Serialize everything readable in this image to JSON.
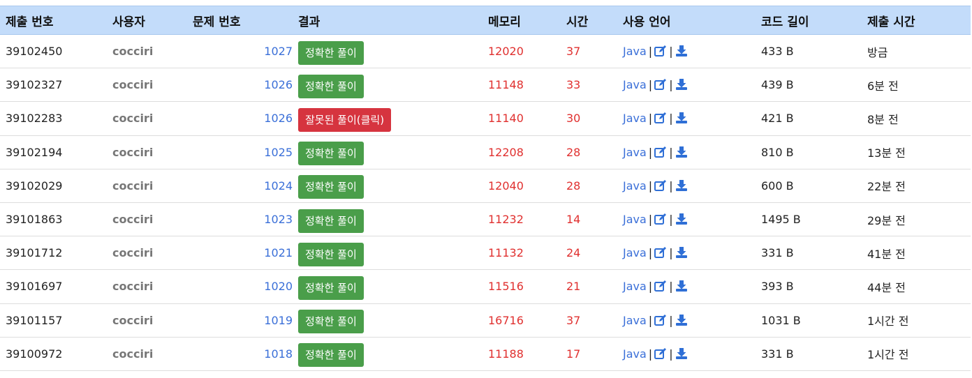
{
  "table": {
    "headers": [
      "제출 번호",
      "사용자",
      "문제 번호",
      "결과",
      "메모리",
      "시간",
      "사용 언어",
      "코드 길이",
      "제출 시간"
    ],
    "rows": [
      {
        "submission_id": "39102450",
        "user": "cocciri",
        "problem": "1027",
        "result": "정확한 풀이",
        "result_type": "ac",
        "memory": "12020",
        "time": "37",
        "language": "Java",
        "code_length": "433 B",
        "submitted": "방금"
      },
      {
        "submission_id": "39102327",
        "user": "cocciri",
        "problem": "1026",
        "result": "정확한 풀이",
        "result_type": "ac",
        "memory": "11148",
        "time": "33",
        "language": "Java",
        "code_length": "439 B",
        "submitted": "6분 전"
      },
      {
        "submission_id": "39102283",
        "user": "cocciri",
        "problem": "1026",
        "result": "잘못된 풀이(클릭)",
        "result_type": "wa",
        "memory": "11140",
        "time": "30",
        "language": "Java",
        "code_length": "421 B",
        "submitted": "8분 전"
      },
      {
        "submission_id": "39102194",
        "user": "cocciri",
        "problem": "1025",
        "result": "정확한 풀이",
        "result_type": "ac",
        "memory": "12208",
        "time": "28",
        "language": "Java",
        "code_length": "810 B",
        "submitted": "13분 전"
      },
      {
        "submission_id": "39102029",
        "user": "cocciri",
        "problem": "1024",
        "result": "정확한 풀이",
        "result_type": "ac",
        "memory": "12040",
        "time": "28",
        "language": "Java",
        "code_length": "600 B",
        "submitted": "22분 전"
      },
      {
        "submission_id": "39101863",
        "user": "cocciri",
        "problem": "1023",
        "result": "정확한 풀이",
        "result_type": "ac",
        "memory": "11232",
        "time": "14",
        "language": "Java",
        "code_length": "1495 B",
        "submitted": "29분 전"
      },
      {
        "submission_id": "39101712",
        "user": "cocciri",
        "problem": "1021",
        "result": "정확한 풀이",
        "result_type": "ac",
        "memory": "11132",
        "time": "24",
        "language": "Java",
        "code_length": "331 B",
        "submitted": "41분 전"
      },
      {
        "submission_id": "39101697",
        "user": "cocciri",
        "problem": "1020",
        "result": "정확한 풀이",
        "result_type": "ac",
        "memory": "11516",
        "time": "21",
        "language": "Java",
        "code_length": "393 B",
        "submitted": "44분 전"
      },
      {
        "submission_id": "39101157",
        "user": "cocciri",
        "problem": "1019",
        "result": "정확한 풀이",
        "result_type": "ac",
        "memory": "16716",
        "time": "37",
        "language": "Java",
        "code_length": "1031 B",
        "submitted": "1시간 전"
      },
      {
        "submission_id": "39100972",
        "user": "cocciri",
        "problem": "1018",
        "result": "정확한 풀이",
        "result_type": "ac",
        "memory": "11188",
        "time": "17",
        "language": "Java",
        "code_length": "331 B",
        "submitted": "1시간 전"
      }
    ]
  },
  "icons": {
    "edit": "edit-icon",
    "download": "download-icon"
  },
  "colors": {
    "header_bg": "#c3dcfa",
    "accepted": "#4a9e4a",
    "wrong": "#d6343f",
    "link": "#3a6fd8",
    "memory_time": "#e0302f",
    "user": "#777777"
  }
}
